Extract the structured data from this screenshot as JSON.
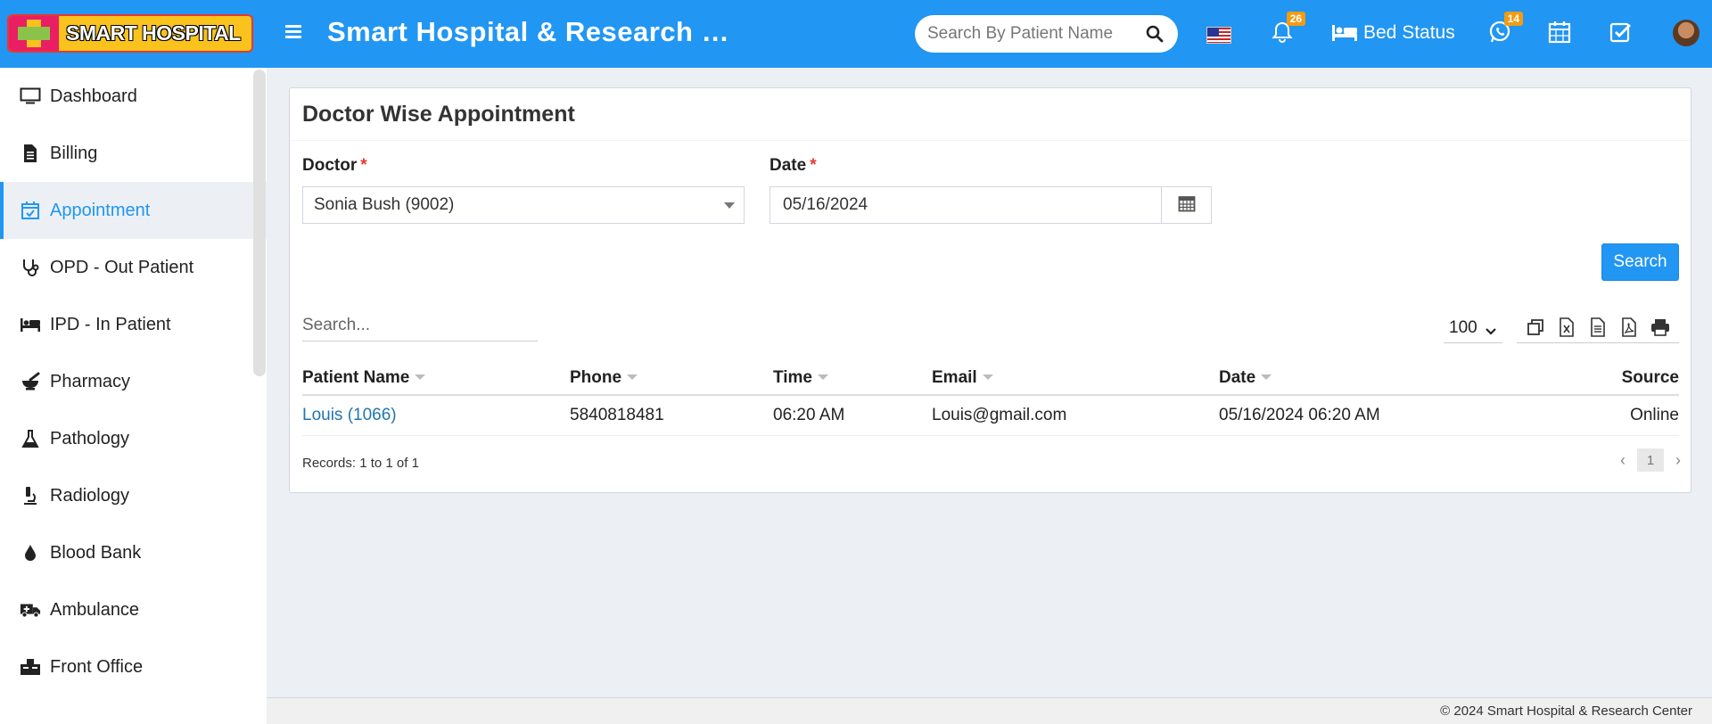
{
  "header": {
    "logo_text": "SMART HOSPITAL",
    "app_title": "Smart Hospital & Research C...",
    "search_placeholder": "Search By Patient Name",
    "notifications_count": "26",
    "bed_status_label": "Bed Status",
    "whatsapp_count": "14"
  },
  "sidebar": {
    "items": [
      {
        "label": "Dashboard",
        "icon": "monitor-icon"
      },
      {
        "label": "Billing",
        "icon": "file-icon"
      },
      {
        "label": "Appointment",
        "icon": "calendar-check-icon",
        "active": true
      },
      {
        "label": "OPD - Out Patient",
        "icon": "stethoscope-icon"
      },
      {
        "label": "IPD - In Patient",
        "icon": "bed-icon"
      },
      {
        "label": "Pharmacy",
        "icon": "mortar-pestle-icon"
      },
      {
        "label": "Pathology",
        "icon": "flask-icon"
      },
      {
        "label": "Radiology",
        "icon": "microscope-icon"
      },
      {
        "label": "Blood Bank",
        "icon": "droplet-icon"
      },
      {
        "label": "Ambulance",
        "icon": "ambulance-icon"
      },
      {
        "label": "Front Office",
        "icon": "desk-icon"
      }
    ]
  },
  "main": {
    "title": "Doctor Wise Appointment",
    "doctor_label": "Doctor",
    "doctor_value": "Sonia Bush (9002)",
    "date_label": "Date",
    "date_value": "05/16/2024",
    "required_mark": "*",
    "search_button": "Search",
    "table_search_placeholder": "Search...",
    "page_length": "100",
    "table": {
      "headers": [
        "Patient Name",
        "Phone",
        "Time",
        "Email",
        "Date",
        "Source"
      ],
      "rows": [
        {
          "patient": "Louis (1066)",
          "phone": "5840818481",
          "time": "06:20 AM",
          "email": "Louis@gmail.com",
          "date": "05/16/2024 06:20 AM",
          "source": "Online"
        }
      ]
    },
    "records_text": "Records: 1 to 1 of 1",
    "current_page": "1"
  },
  "footer": {
    "copyright": "© 2024 Smart Hospital & Research Center"
  },
  "colors": {
    "primary": "#2196f3",
    "badge": "#f39c12",
    "required": "#e53935",
    "link": "#2176ae"
  }
}
